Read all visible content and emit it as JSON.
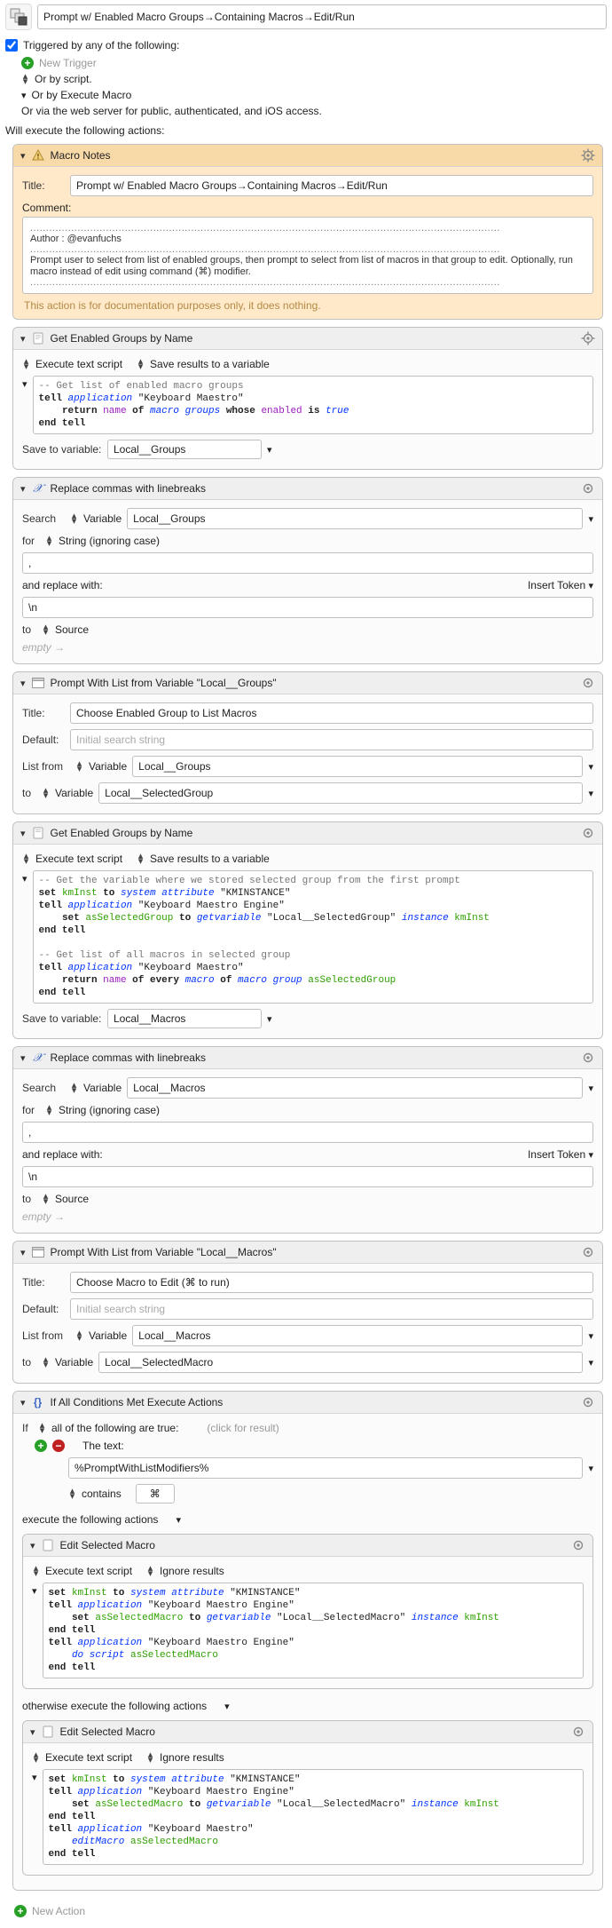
{
  "titlebar": {
    "title": "Prompt w/ Enabled Macro Groups→Containing Macros→Edit/Run"
  },
  "triggers": {
    "enabled_label": "Triggered by any of the following:",
    "new_trigger": "New Trigger",
    "by_script": "Or by script.",
    "by_execute_macro": "Or by Execute Macro",
    "by_web": "Or via the web server for public, authenticated, and iOS access."
  },
  "exec_label": "Will execute the following actions:",
  "notes": {
    "header": "Macro Notes",
    "title_label": "Title:",
    "title_value": "Prompt w/ Enabled Macro Groups→Containing Macros→Edit/Run",
    "comment_label": "Comment:",
    "author_line": "Author    :  @evanfuchs",
    "body": "Prompt user to select from list of enabled groups, then prompt to select from list of macros in that group to edit. Optionally, run macro instead of edit using command (⌘) modifier.",
    "footer": "This action is for documentation purposes only, it does nothing."
  },
  "get_groups": {
    "header": "Get Enabled Groups by Name",
    "exec_type": "Execute text script",
    "save_mode": "Save results to a variable",
    "save_label": "Save to variable:",
    "save_var": "Local__Groups"
  },
  "replace1": {
    "header": "Replace commas with linebreaks",
    "search_label": "Search",
    "var_mode": "Variable",
    "var_name": "Local__Groups",
    "for_label": "for",
    "for_mode": "String (ignoring case)",
    "for_value": ",",
    "replace_label": "and replace with:",
    "insert_token": "Insert Token",
    "replace_value": "\\n",
    "to_label": "to",
    "to_mode": "Source",
    "to_value": "empty"
  },
  "prompt_groups": {
    "header": "Prompt With List from Variable \"Local__Groups\"",
    "title_label": "Title:",
    "title_value": "Choose Enabled Group to List Macros",
    "default_label": "Default:",
    "default_placeholder": "Initial search string",
    "listfrom_label": "List from",
    "listfrom_mode": "Variable",
    "listfrom_var": "Local__Groups",
    "to_label": "to",
    "to_mode": "Variable",
    "to_var": "Local__SelectedGroup"
  },
  "get_macros": {
    "header": "Get Enabled Groups by Name",
    "exec_type": "Execute text script",
    "save_mode": "Save results to a variable",
    "save_label": "Save to variable:",
    "save_var": "Local__Macros"
  },
  "replace2": {
    "header": "Replace commas with linebreaks",
    "search_label": "Search",
    "var_mode": "Variable",
    "var_name": "Local__Macros",
    "for_label": "for",
    "for_mode": "String (ignoring case)",
    "for_value": ",",
    "replace_label": "and replace with:",
    "insert_token": "Insert Token",
    "replace_value": "\\n",
    "to_label": "to",
    "to_mode": "Source",
    "to_value": "empty"
  },
  "prompt_macros": {
    "header": "Prompt With List from Variable \"Local__Macros\"",
    "title_label": "Title:",
    "title_value": "Choose Macro to Edit (⌘ to run)",
    "default_label": "Default:",
    "default_placeholder": "Initial search string",
    "listfrom_label": "List from",
    "listfrom_mode": "Variable",
    "listfrom_var": "Local__Macros",
    "to_label": "to",
    "to_mode": "Variable",
    "to_var": "Local__SelectedMacro"
  },
  "ifblock": {
    "header": "If All Conditions Met Execute Actions",
    "if_label": "If",
    "if_mode": "all of the following are true:",
    "hint": "(click for result)",
    "cond_text_label": "The text:",
    "cond_text_value": "%PromptWithListModifiers%",
    "cond_op": "contains",
    "cond_value": "⌘",
    "exec_label": "execute the following actions",
    "otherwise_label": "otherwise execute the following actions",
    "sub_header": "Edit Selected Macro",
    "sub_exec_type": "Execute text script",
    "sub_save_mode": "Ignore results"
  },
  "new_action": "New Action"
}
